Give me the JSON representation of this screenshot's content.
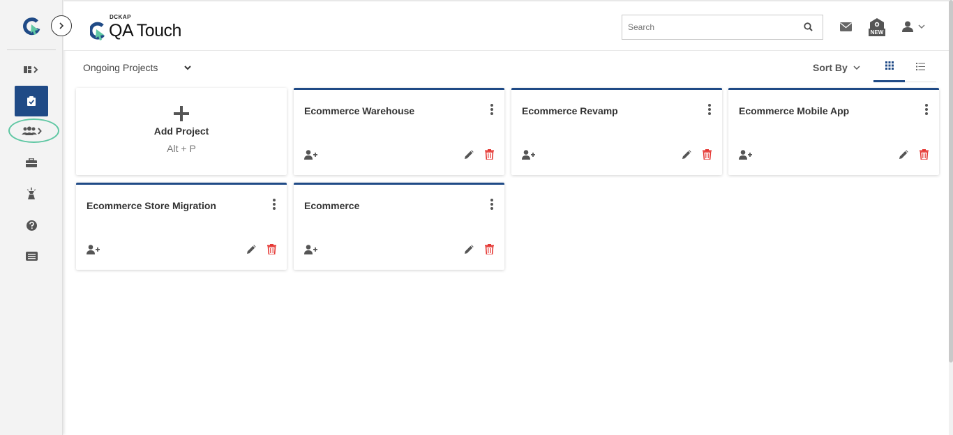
{
  "brand": {
    "small": "DCKAP",
    "name": "QA Touch"
  },
  "search": {
    "placeholder": "Search"
  },
  "header_icons": [
    "mail-icon",
    "new-feature-icon",
    "user-icon"
  ],
  "new_badge": "NEW",
  "filter": {
    "selected": "Ongoing Projects"
  },
  "sort": {
    "label": "Sort By"
  },
  "add_card": {
    "title": "Add Project",
    "shortcut": "Alt + P"
  },
  "projects": [
    {
      "name": "Ecommerce Warehouse"
    },
    {
      "name": "Ecommerce Revamp"
    },
    {
      "name": "Ecommerce Mobile App"
    },
    {
      "name": "Ecommerce Store Migration"
    },
    {
      "name": "Ecommerce"
    }
  ],
  "sidebar": [
    "dashboard-icon",
    "projects-icon",
    "users-icon",
    "briefcase-icon",
    "tower-icon",
    "help-icon",
    "reports-icon"
  ],
  "colors": {
    "primary": "#1f4a86",
    "accent": "#5fc7a3",
    "delete": "#e53935"
  }
}
